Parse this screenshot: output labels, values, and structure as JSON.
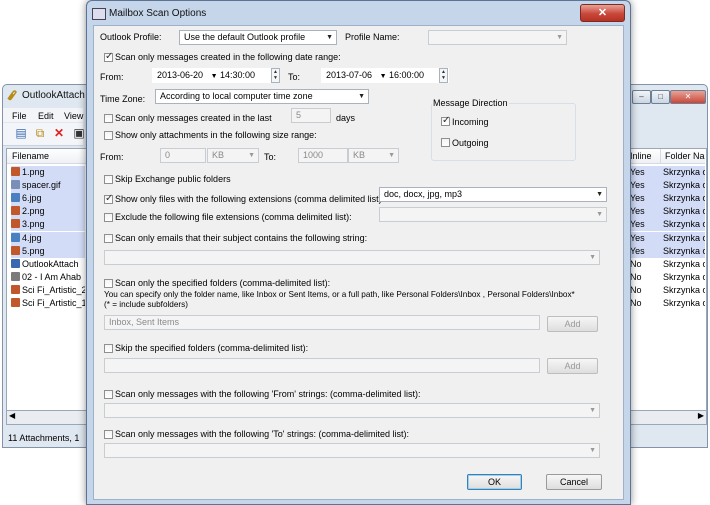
{
  "background_window": {
    "title": "OutlookAttach",
    "menu": [
      "File",
      "Edit",
      "View"
    ],
    "column_filename": "Filename",
    "column_inline": "Inline",
    "column_folder": "Folder Na",
    "files": [
      {
        "name": "1.png",
        "inline": "Yes",
        "folder": "Skrzynka o",
        "selected": true,
        "icon_color": "#c0582c"
      },
      {
        "name": "spacer.gif",
        "inline": "Yes",
        "folder": "Skrzynka o",
        "selected": true,
        "icon_color": "#7a8fb8"
      },
      {
        "name": "6.jpg",
        "inline": "Yes",
        "folder": "Skrzynka o",
        "selected": true,
        "icon_color": "#4a7fc0"
      },
      {
        "name": "2.png",
        "inline": "Yes",
        "folder": "Skrzynka o",
        "selected": true,
        "icon_color": "#c0582c"
      },
      {
        "name": "3.png",
        "inline": "Yes",
        "folder": "Skrzynka o",
        "selected": true,
        "icon_color": "#c0582c"
      },
      {
        "name": "4.jpg",
        "inline": "Yes",
        "folder": "Skrzynka o",
        "selected": true,
        "icon_color": "#4a7fc0"
      },
      {
        "name": "5.png",
        "inline": "Yes",
        "folder": "Skrzynka o",
        "selected": true,
        "icon_color": "#c0582c"
      },
      {
        "name": "OutlookAttach",
        "inline": "No",
        "folder": "Skrzynka o",
        "selected": false,
        "icon_color": "#3a68b0"
      },
      {
        "name": "02 - I Am Ahab",
        "inline": "No",
        "folder": "Skrzynka o",
        "selected": false,
        "icon_color": "#7b7b7b"
      },
      {
        "name": "Sci Fi_Artistic_2",
        "inline": "No",
        "folder": "Skrzynka o",
        "selected": false,
        "icon_color": "#c0582c"
      },
      {
        "name": "Sci Fi_Artistic_1",
        "inline": "No",
        "folder": "Skrzynka o",
        "selected": false,
        "icon_color": "#c0582c"
      }
    ],
    "status": "11 Attachments, 1"
  },
  "dialog": {
    "title": "Mailbox Scan Options",
    "close_glyph": "✕",
    "outlook_profile_label": "Outlook Profile:",
    "outlook_profile_value": "Use the default Outlook profile",
    "profile_name_label": "Profile Name:",
    "profile_name_value": "",
    "scan_date_range_label": "Scan only messages created in the following date range:",
    "scan_date_range_checked": true,
    "from_label": "From:",
    "from_date": "2013-06-20",
    "from_time": "14:30:00",
    "to_label": "To:",
    "to_date": "2013-07-06",
    "to_time": "16:00:00",
    "time_zone_label": "Time Zone:",
    "time_zone_value": "According to local computer time zone",
    "scan_last_label": "Scan only messages created in the last",
    "scan_last_value": "5",
    "scan_last_unit": "days",
    "scan_last_checked": false,
    "size_range_label": "Show only attachments in the following size range:",
    "size_range_checked": false,
    "size_from_label": "From:",
    "size_from_value": "0",
    "size_from_unit": "KB",
    "size_to_label": "To:",
    "size_to_value": "1000",
    "size_to_unit": "KB",
    "message_direction_label": "Message Direction",
    "incoming_label": "Incoming",
    "incoming_checked": true,
    "outgoing_label": "Outgoing",
    "outgoing_checked": false,
    "skip_exchange_label": "Skip Exchange public folders",
    "skip_exchange_checked": false,
    "show_ext_label": "Show only files with the following extensions (comma delimited list):",
    "show_ext_checked": true,
    "show_ext_value": "doc, docx, jpg, mp3",
    "exclude_ext_label": "Exclude the following file extensions (comma delimited list):",
    "exclude_ext_checked": false,
    "exclude_ext_value": "",
    "subject_label": "Scan only emails that their subject contains the following string:",
    "subject_checked": false,
    "subject_value": "",
    "folders_label": "Scan only the specified folders (comma-delimited list):",
    "folders_checked": false,
    "folders_help_1": "You can specify only the folder name, like Inbox or Sent Items, or a full path, like Personal Folders\\Inbox , Personal Folders\\Inbox*",
    "folders_help_2": "(* = include subfolders)",
    "folders_value": "Inbox, Sent Items",
    "add_label": "Add",
    "skip_folders_label": "Skip the specified folders (comma-delimited list):",
    "skip_folders_checked": false,
    "skip_folders_value": "",
    "from_strings_label": "Scan only messages with the following 'From' strings: (comma-delimited list):",
    "from_strings_checked": false,
    "from_strings_value": "",
    "to_strings_label": "Scan only messages with the following 'To' strings: (comma-delimited list):",
    "to_strings_checked": false,
    "to_strings_value": "",
    "ok_label": "OK",
    "cancel_label": "Cancel"
  }
}
